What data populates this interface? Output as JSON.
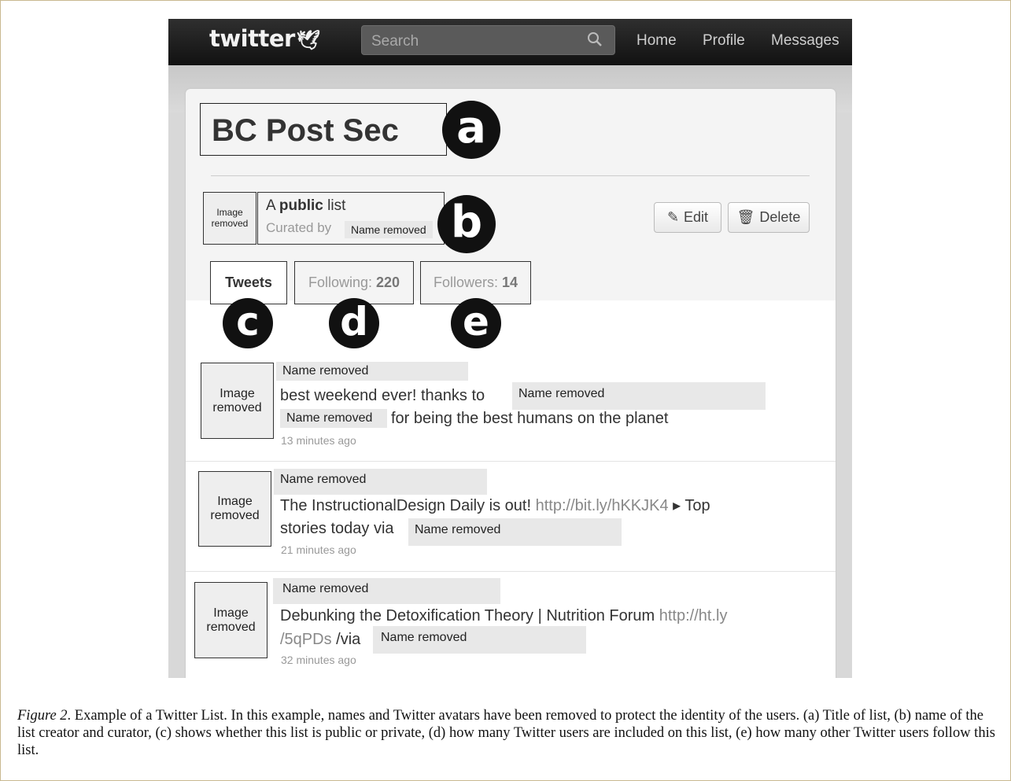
{
  "topbar": {
    "logo": "twitter",
    "search_placeholder": "Search",
    "nav": [
      "Home",
      "Profile",
      "Messages"
    ]
  },
  "list": {
    "title": "BC Post Sec",
    "avatar_label": "Image removed",
    "desc_prefix": "A ",
    "desc_bold": "public",
    "desc_suffix": " list",
    "curated_by": "Curated by",
    "curator": "Name removed",
    "edit_label": "Edit",
    "delete_label": "Delete"
  },
  "tabs": {
    "tweets": "Tweets",
    "following_label": "Following:",
    "following_count": "220",
    "followers_label": "Followers:",
    "followers_count": "14"
  },
  "markers": [
    "a",
    "b",
    "c",
    "d",
    "e"
  ],
  "tweets": [
    {
      "avatar": "Image removed",
      "author": "Name removed",
      "text1": "best weekend ever! thanks to",
      "mention1": "Name removed",
      "mention2": "Name removed",
      "text2": "for being the best humans on the planet",
      "time": "13 minutes ago"
    },
    {
      "avatar": "Image removed",
      "author": "Name removed",
      "text1": "The InstructionalDesign Daily is out!",
      "link": "http://bit.ly/hKKJK4",
      "text2": "▸ Top",
      "text3": "stories today via",
      "mention": "Name removed",
      "time": "21 minutes ago"
    },
    {
      "avatar": "Image removed",
      "author": "Name removed",
      "text1": "Debunking the Detoxification Theory | Nutrition Forum",
      "link1": "http://ht.ly",
      "link2": "/5qPDs",
      "text2": "/via",
      "mention": "Name removed",
      "time": "32 minutes ago"
    }
  ],
  "caption": {
    "figure": "Figure 2",
    "text": ". Example of a Twitter List. In this example, names and Twitter avatars have been removed to protect the identity of the users. (a) Title of list, (b) name of the list creator and curator, (c) shows whether this list is public or private, (d) how many Twitter users are included on this list, (e) how many other Twitter users follow this list."
  }
}
